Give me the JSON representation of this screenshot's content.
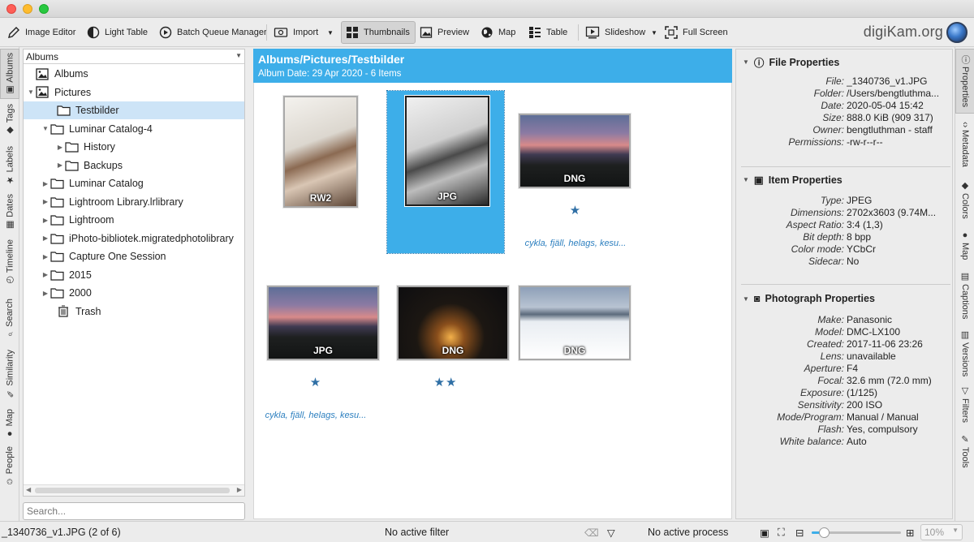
{
  "toolbar": {
    "image_editor": "Image Editor",
    "light_table": "Light Table",
    "batch_queue": "Batch Queue Manager",
    "import": "Import",
    "thumbnails": "Thumbnails",
    "preview": "Preview",
    "map": "Map",
    "table": "Table",
    "slideshow": "Slideshow",
    "full_screen": "Full Screen",
    "brand": "digiKam.org"
  },
  "left_tabs": [
    "Albums",
    "Tags",
    "Labels",
    "Dates",
    "Timeline",
    "Search",
    "Similarity",
    "Map",
    "People"
  ],
  "right_tabs": [
    "Properties",
    "Metadata",
    "Colors",
    "Map",
    "Captions",
    "Versions",
    "Filters",
    "Tools"
  ],
  "album_panel": {
    "combo": "Albums",
    "tree": [
      {
        "label": "Albums",
        "expander": "",
        "icon": "album-root-icon"
      },
      {
        "label": "Pictures",
        "expander": "▼",
        "icon": "album-root-icon"
      },
      {
        "label": "Testbilder",
        "expander": "",
        "icon": "folder-icon",
        "selected": true
      },
      {
        "label": "Luminar Catalog-4",
        "expander": "▼",
        "icon": "folder-icon"
      },
      {
        "label": "History",
        "expander": "▶",
        "icon": "folder-icon"
      },
      {
        "label": "Backups",
        "expander": "▶",
        "icon": "folder-icon"
      },
      {
        "label": "Luminar Catalog",
        "expander": "▶",
        "icon": "folder-icon"
      },
      {
        "label": "Lightroom Library.lrlibrary",
        "expander": "▶",
        "icon": "folder-icon"
      },
      {
        "label": "Lightroom",
        "expander": "▶",
        "icon": "folder-icon"
      },
      {
        "label": "iPhoto-bibliotek.migratedphotolibrary",
        "expander": "▶",
        "icon": "folder-icon"
      },
      {
        "label": "Capture One Session",
        "expander": "▶",
        "icon": "folder-icon"
      },
      {
        "label": "2015",
        "expander": "▶",
        "icon": "folder-icon"
      },
      {
        "label": "2000",
        "expander": "▶",
        "icon": "folder-icon"
      },
      {
        "label": "Trash",
        "expander": "",
        "icon": "trash-icon"
      }
    ],
    "search_placeholder": "Search..."
  },
  "center": {
    "title": "Albums/Pictures/Testbilder",
    "subtitle": "Album Date: 29 Apr 2020 - 6 Items",
    "items": [
      {
        "format": "RW2",
        "stars": "",
        "tags": "",
        "selected": false,
        "image": "portrait-color"
      },
      {
        "format": "JPG",
        "stars": "",
        "tags": "",
        "selected": true,
        "image": "portrait-bw"
      },
      {
        "format": "DNG",
        "stars": "★",
        "tags": "cykla, fjäll, helags, kesu...",
        "selected": false,
        "image": "sunset-bike"
      },
      {
        "format": "JPG",
        "stars": "★",
        "tags": "cykla, fjäll, helags, kesu...",
        "selected": false,
        "image": "sunset-bike"
      },
      {
        "format": "DNG",
        "stars": "★★",
        "tags": "",
        "selected": false,
        "image": "night-cabin"
      },
      {
        "format": "DNG",
        "stars": "",
        "tags": "",
        "selected": false,
        "image": "ski-snow"
      }
    ]
  },
  "properties": {
    "file": {
      "title": "File Properties",
      "rows": [
        {
          "k": "File:",
          "v": "_1340736_v1.JPG"
        },
        {
          "k": "Folder:",
          "v": "/Users/bengtluthma..."
        },
        {
          "k": "Date:",
          "v": "2020-05-04 15:42"
        },
        {
          "k": "Size:",
          "v": "888.0 KiB (909 317)"
        },
        {
          "k": "Owner:",
          "v": "bengtluthman - staff"
        },
        {
          "k": "Permissions:",
          "v": "-rw-r--r--"
        }
      ]
    },
    "item": {
      "title": "Item Properties",
      "rows": [
        {
          "k": "Type:",
          "v": "JPEG"
        },
        {
          "k": "Dimensions:",
          "v": "2702x3603 (9.74M..."
        },
        {
          "k": "Aspect Ratio:",
          "v": "3:4 (1,3)"
        },
        {
          "k": "Bit depth:",
          "v": "8 bpp"
        },
        {
          "k": "Color mode:",
          "v": "YCbCr"
        },
        {
          "k": "Sidecar:",
          "v": "No"
        }
      ]
    },
    "photo": {
      "title": "Photograph Properties",
      "rows": [
        {
          "k": "Make:",
          "v": "Panasonic"
        },
        {
          "k": "Model:",
          "v": "DMC-LX100"
        },
        {
          "k": "Created:",
          "v": "2017-11-06 23:26"
        },
        {
          "k": "Lens:",
          "v": "unavailable"
        },
        {
          "k": "Aperture:",
          "v": "F4"
        },
        {
          "k": "Focal:",
          "v": "32.6 mm (72.0 mm)"
        },
        {
          "k": "Exposure:",
          "v": "(1/125)"
        },
        {
          "k": "Sensitivity:",
          "v": "200 ISO"
        },
        {
          "k": "Mode/Program:",
          "v": "Manual / Manual"
        },
        {
          "k": "Flash:",
          "v": "Yes, compulsory"
        },
        {
          "k": "White balance:",
          "v": "Auto"
        }
      ]
    }
  },
  "status": {
    "file_info": "_1340736_v1.JPG (2 of 6)",
    "filter": "No active filter",
    "process": "No active process",
    "zoom": "10%",
    "zoom_level": 0.14
  },
  "colors": {
    "accent": "#3daee9",
    "star": "#2f6fa5",
    "tag_text": "#2c7fbf"
  }
}
